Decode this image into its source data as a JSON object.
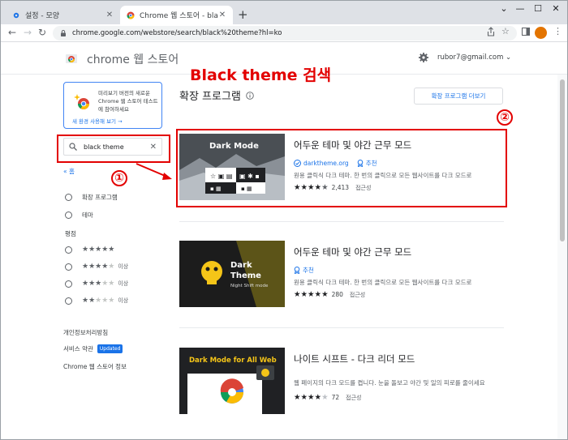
{
  "browser": {
    "tabs": [
      {
        "title": "설정 - 모양",
        "active": false
      },
      {
        "title": "Chrome 웹 스토어 - black theme",
        "active": true
      }
    ],
    "url": "chrome.google.com/webstore/search/black%20theme?hl=ko"
  },
  "store": {
    "title": "chrome 웹 스토어",
    "account": "rubor7@gmail.com"
  },
  "sidebar": {
    "promo_text": "미리보기 버전의 새로운 Chrome 웹 스토어 테스트에 참여하세요",
    "promo_link": "새 환경 사용해 보기 →",
    "search_value": "black theme",
    "home_link": "« 홈",
    "type_options": [
      "확장 프로그램",
      "테마"
    ],
    "rating_label": "평점",
    "rating_filters": [
      {
        "stars": 5,
        "suffix": ""
      },
      {
        "stars": 4,
        "suffix": "이상"
      },
      {
        "stars": 3,
        "suffix": "이상"
      },
      {
        "stars": 2,
        "suffix": "이상"
      }
    ],
    "footer_links": {
      "privacy": "개인정보처리방침",
      "terms": "서비스 약관",
      "terms_badge": "Updated",
      "about": "Chrome 웹 스토어 정보"
    }
  },
  "main": {
    "title": "확장 프로그램",
    "more_button": "확장 프로그램 더보기",
    "items": [
      {
        "name": "어두운 테마 및 야간 근무 모드",
        "publisher": "darktheme.org",
        "featured": "추천",
        "description": "원용 클릭식 다크 테마. 한 번의 클릭으로 모든 웹사이트를 다크 모드로",
        "rating": 4.5,
        "count": "2,413",
        "category": "접근성",
        "thumb_title": "Dark Mode"
      },
      {
        "name": "어두운 테마 및 야간 근무 모드",
        "publisher": "",
        "featured": "추천",
        "description": "원용 클릭식 다크 테마. 한 번의 클릭으로 모든 웹사이트를 다크 모드로",
        "rating": 5,
        "count": "280",
        "category": "접근성",
        "thumb_title": "Dark Theme",
        "thumb_sub": "Night Shift mode"
      },
      {
        "name": "나이트 시프트 - 다크 리더 모드",
        "publisher": "",
        "featured": "",
        "description": "웹 페이지의 다크 모드를 켭니다. 눈을 돌보고 야간 및 일의 피로를 줄이세요",
        "rating": 4,
        "count": "72",
        "category": "접근성",
        "thumb_title": "Dark Mode for All Web"
      }
    ]
  },
  "annotations": {
    "title": "Black theme 검색",
    "marker1": "①",
    "marker2": "②"
  },
  "colors": {
    "annotation": "#e30000",
    "link": "#1a73e8",
    "tabstrip": "#dee1e6"
  }
}
